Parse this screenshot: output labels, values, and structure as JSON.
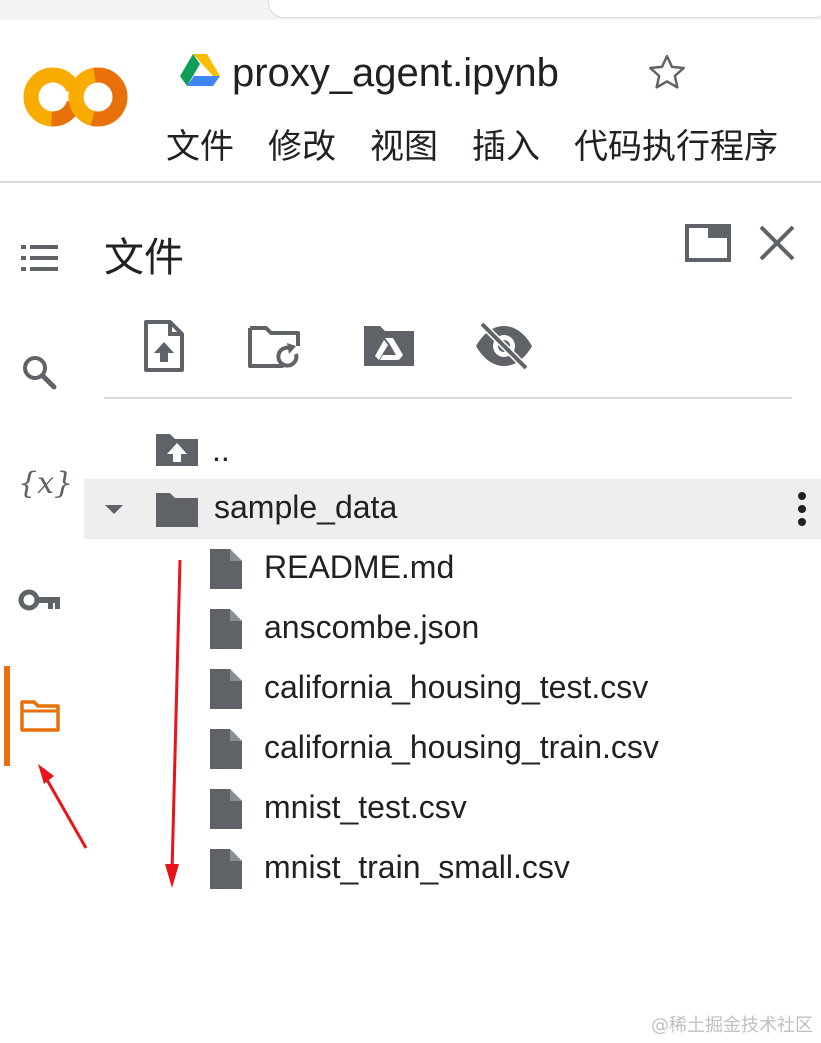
{
  "header": {
    "notebook_title": "proxy_agent.ipynb",
    "menu": [
      "文件",
      "修改",
      "视图",
      "插入",
      "代码执行程序"
    ]
  },
  "rail": {
    "items": [
      "table-of-contents-icon",
      "search-icon",
      "variables-icon",
      "key-icon",
      "folder-icon"
    ],
    "variables_glyph": "{x}",
    "active": "folder-icon"
  },
  "panel": {
    "title": "文件",
    "toolbar": [
      "upload-file-icon",
      "refresh-folder-icon",
      "mount-drive-icon",
      "hide-hidden-files-icon"
    ]
  },
  "tree": {
    "parent_label": "..",
    "folder": {
      "name": "sample_data",
      "expanded": true
    },
    "files": [
      "README.md",
      "anscombe.json",
      "california_housing_test.csv",
      "california_housing_train.csv",
      "mnist_test.csv",
      "mnist_train_small.csv"
    ]
  },
  "watermark": "@稀土掘金技术社区",
  "colors": {
    "accent_orange": "#e8710a",
    "annotation_red": "#e8141b",
    "icon_gray": "#5f6368"
  }
}
